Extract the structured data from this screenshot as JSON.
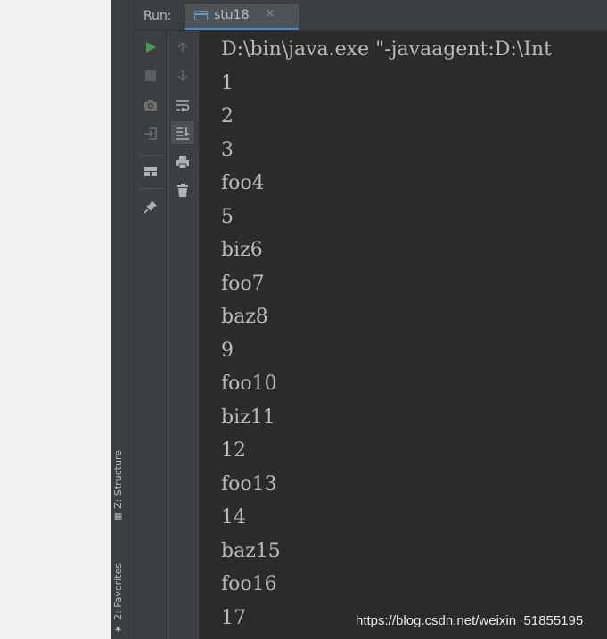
{
  "run_panel": {
    "label": "Run:",
    "tab": {
      "title": "stu18",
      "close_glyph": "×",
      "icon": "console-icon"
    }
  },
  "toolbar_left": [
    {
      "name": "rerun-button",
      "icon": "play-icon",
      "color": "#499c54"
    },
    {
      "name": "stop-button",
      "icon": "stop-icon",
      "color": "#5e6060"
    },
    {
      "name": "dump-threads-button",
      "icon": "camera-icon"
    },
    {
      "name": "exit-button",
      "icon": "exit-icon"
    },
    {
      "name": "layout-button",
      "icon": "layout-icon"
    },
    {
      "name": "pin-tab-button",
      "icon": "pin-icon"
    }
  ],
  "toolbar_right": [
    {
      "name": "up-stack-button",
      "icon": "arrow-up-icon"
    },
    {
      "name": "down-stack-button",
      "icon": "arrow-down-icon"
    },
    {
      "name": "soft-wrap-button",
      "icon": "soft-wrap-icon"
    },
    {
      "name": "scroll-to-end-button",
      "icon": "scroll-to-end-icon",
      "active": true
    },
    {
      "name": "print-button",
      "icon": "print-icon"
    },
    {
      "name": "clear-all-button",
      "icon": "trash-icon"
    }
  ],
  "side_stripe": {
    "structure": "Z: Structure",
    "favorites": "2: Favorites"
  },
  "console": {
    "lines": [
      "D:\\bin\\java.exe \"-javaagent:D:\\Int",
      "1",
      "2",
      "3",
      "foo4",
      "5",
      "biz6",
      "foo7",
      "baz8",
      "9",
      "foo10",
      "biz11",
      "12",
      "foo13",
      "14",
      "baz15",
      "foo16",
      "17"
    ]
  },
  "watermark": "https://blog.csdn.net/weixin_51855195",
  "colors": {
    "background": "#2b2b2b",
    "panel": "#3c3f41",
    "text": "#bababa",
    "accent": "#4a88c7"
  }
}
